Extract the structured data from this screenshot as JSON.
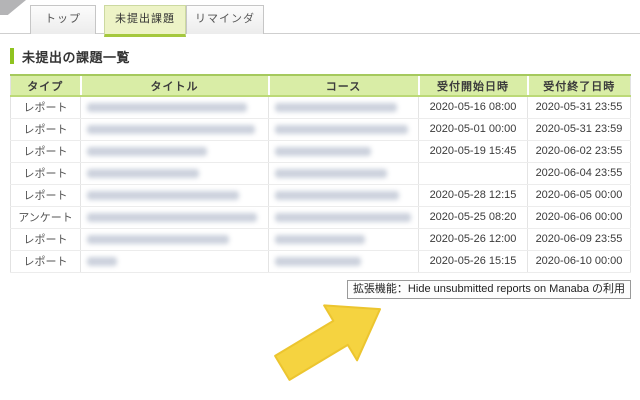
{
  "tabs": [
    {
      "label": "トップ",
      "active": false
    },
    {
      "label": "未提出課題",
      "active": true
    },
    {
      "label": "リマインダ",
      "active": false
    }
  ],
  "page": {
    "title": "未提出の課題一覧"
  },
  "table": {
    "headers": [
      "タイプ",
      "タイトル",
      "コース",
      "受付開始日時",
      "受付終了日時"
    ],
    "rows": [
      {
        "type": "レポート",
        "title_redacted": true,
        "course_redacted": true,
        "start": "2020-05-16 08:00",
        "end": "2020-05-31 23:55",
        "title_w": 160,
        "course_w": 122
      },
      {
        "type": "レポート",
        "title_redacted": true,
        "course_redacted": true,
        "start": "2020-05-01 00:00",
        "end": "2020-05-31 23:59",
        "title_w": 168,
        "course_w": 133
      },
      {
        "type": "レポート",
        "title_redacted": true,
        "course_redacted": true,
        "start": "2020-05-19 15:45",
        "end": "2020-06-02 23:55",
        "title_w": 120,
        "course_w": 96
      },
      {
        "type": "レポート",
        "title_redacted": true,
        "course_redacted": true,
        "start": "",
        "end": "2020-06-04 23:55",
        "title_w": 112,
        "course_w": 112
      },
      {
        "type": "レポート",
        "title_redacted": true,
        "course_redacted": true,
        "start": "2020-05-28 12:15",
        "end": "2020-06-05 00:00",
        "title_w": 152,
        "course_w": 124
      },
      {
        "type": "アンケート",
        "title_redacted": true,
        "course_redacted": true,
        "start": "2020-05-25 08:20",
        "end": "2020-06-06 00:00",
        "title_w": 170,
        "course_w": 136
      },
      {
        "type": "レポート",
        "title_redacted": true,
        "course_redacted": true,
        "start": "2020-05-26 12:00",
        "end": "2020-06-09 23:55",
        "title_w": 142,
        "course_w": 90
      },
      {
        "type": "レポート",
        "title_redacted": true,
        "course_redacted": true,
        "start": "2020-05-26 15:15",
        "end": "2020-06-10 00:00",
        "title_w": 30,
        "course_w": 86
      }
    ]
  },
  "tooltip": {
    "text": "拡張機能：Hide unsubmitted reports on Manaba の利用"
  },
  "icons": {
    "corner_triangle": "gray-corner-triangle",
    "arrow": "yellow-arrow-up-right"
  },
  "colors": {
    "accent_green": "#8fc31f",
    "header_bg": "#d9eda6",
    "active_tab_bg": "#edf3c6",
    "active_tab_underline": "#a5c83e",
    "arrow_yellow": "#f5d340"
  }
}
